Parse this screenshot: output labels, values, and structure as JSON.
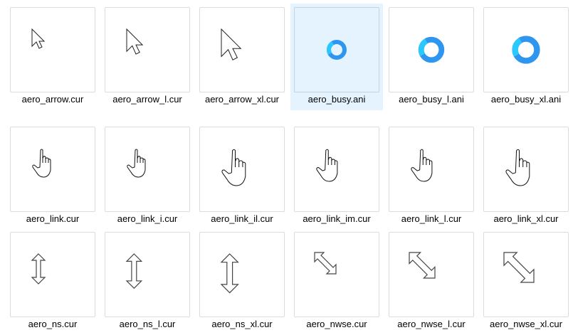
{
  "files": [
    {
      "name": "aero_arrow.cur",
      "icon": "arrow-icon",
      "size": 1
    },
    {
      "name": "aero_arrow_l.cur",
      "icon": "arrow-icon",
      "size": 1.3
    },
    {
      "name": "aero_arrow_xl.cur",
      "icon": "arrow-icon",
      "size": 1.6
    },
    {
      "name": "aero_busy.ani",
      "icon": "busy-icon",
      "size": 1,
      "selected": true
    },
    {
      "name": "aero_busy_l.ani",
      "icon": "busy-icon",
      "size": 1.3
    },
    {
      "name": "aero_busy_xl.ani",
      "icon": "busy-icon",
      "size": 1.4
    },
    {
      "name": "aero_link.cur",
      "icon": "hand-icon",
      "size": 1
    },
    {
      "name": "aero_link_i.cur",
      "icon": "hand-icon",
      "size": 1
    },
    {
      "name": "aero_link_il.cur",
      "icon": "hand-icon",
      "size": 1.3
    },
    {
      "name": "aero_link_im.cur",
      "icon": "hand-icon",
      "size": 1.15
    },
    {
      "name": "aero_link_l.cur",
      "icon": "hand-icon",
      "size": 1.15
    },
    {
      "name": "aero_link_xl.cur",
      "icon": "hand-icon",
      "size": 1.3
    },
    {
      "name": "aero_ns.cur",
      "icon": "ns-arrow-icon",
      "size": 1
    },
    {
      "name": "aero_ns_l.cur",
      "icon": "ns-arrow-icon",
      "size": 1.15
    },
    {
      "name": "aero_ns_xl.cur",
      "icon": "ns-arrow-icon",
      "size": 1.3
    },
    {
      "name": "aero_nwse.cur",
      "icon": "nwse-arrow-icon",
      "size": 1
    },
    {
      "name": "aero_nwse_l.cur",
      "icon": "nwse-arrow-icon",
      "size": 1.2
    },
    {
      "name": "aero_nwse_xl.cur",
      "icon": "nwse-arrow-icon",
      "size": 1.4
    }
  ],
  "colors": {
    "selection": "#e5f3ff",
    "busy_ring": "#2f96f0",
    "busy_accent": "#2bc8ff"
  }
}
